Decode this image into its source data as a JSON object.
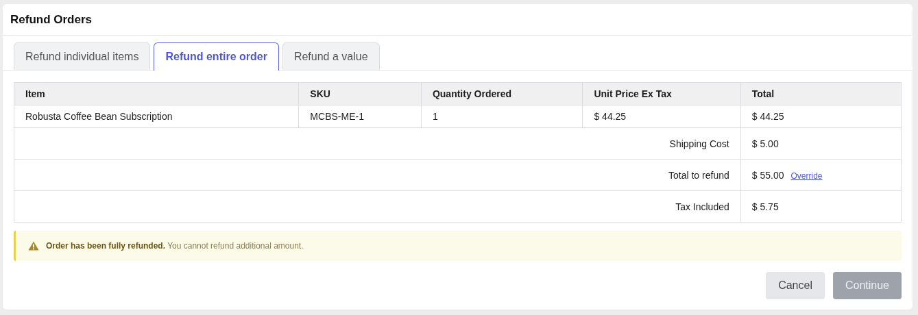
{
  "window": {
    "title": "Refund Orders"
  },
  "tabs": [
    {
      "label": "Refund individual items",
      "selected": false
    },
    {
      "label": "Refund entire order",
      "selected": true
    },
    {
      "label": "Refund a value",
      "selected": false
    }
  ],
  "table": {
    "columns": [
      "Item",
      "SKU",
      "Quantity Ordered",
      "Unit Price Ex Tax",
      "Total"
    ],
    "rows": [
      [
        "Robusta Coffee Bean Subscription",
        "MCBS-ME-1",
        "1",
        "$ 44.25",
        "$ 44.25"
      ]
    ],
    "summary": [
      {
        "label": "Shipping Cost",
        "value": "$ 5.00"
      },
      {
        "label": "Total to refund",
        "value": "$ 55.00",
        "link": "Override"
      },
      {
        "label": "Tax Included",
        "value": "$ 5.75"
      }
    ]
  },
  "alert": {
    "kind": "warning",
    "text": "**Order has been fully refunded.** You cannot refund additional amount."
  },
  "buttons": [
    {
      "label": "Cancel",
      "kind": "secondary",
      "disabled": false
    },
    {
      "label": "Continue",
      "kind": "primary",
      "disabled": true
    }
  ]
}
